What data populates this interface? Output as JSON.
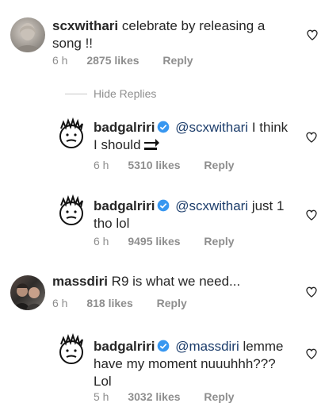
{
  "thread": {
    "comment1": {
      "username": "scxwithari",
      "text": "celebrate by releasing a song !!",
      "time": "6 h",
      "likes": "2875 likes",
      "reply": "Reply"
    },
    "hide_replies": "Hide Replies",
    "reply1": {
      "username": "badgalriri",
      "mention": "@scxwithari",
      "text": "I think I should",
      "time": "6 h",
      "likes": "5310 likes",
      "reply": "Reply"
    },
    "reply2": {
      "username": "badgalriri",
      "mention": "@scxwithari",
      "text": "just 1 tho lol",
      "time": "6 h",
      "likes": "9495 likes",
      "reply": "Reply"
    },
    "comment2": {
      "username": "massdiri",
      "text": "R9 is what we need...",
      "time": "6 h",
      "likes": "818 likes",
      "reply": "Reply"
    },
    "reply3": {
      "username": "badgalriri",
      "mention": "@massdiri",
      "text": "lemme have my moment nuuuhhh??? Lol",
      "time": "5 h",
      "likes": "3032 likes",
      "reply": "Reply"
    }
  },
  "icons": {
    "heart": "heart-outline-icon",
    "verified": "verified-badge-icon",
    "soon": "soon-arrow-emoji"
  },
  "colors": {
    "text": "#262626",
    "meta": "#8e8e8e",
    "mention": "#1c3d6b",
    "verified": "#3897f0"
  }
}
